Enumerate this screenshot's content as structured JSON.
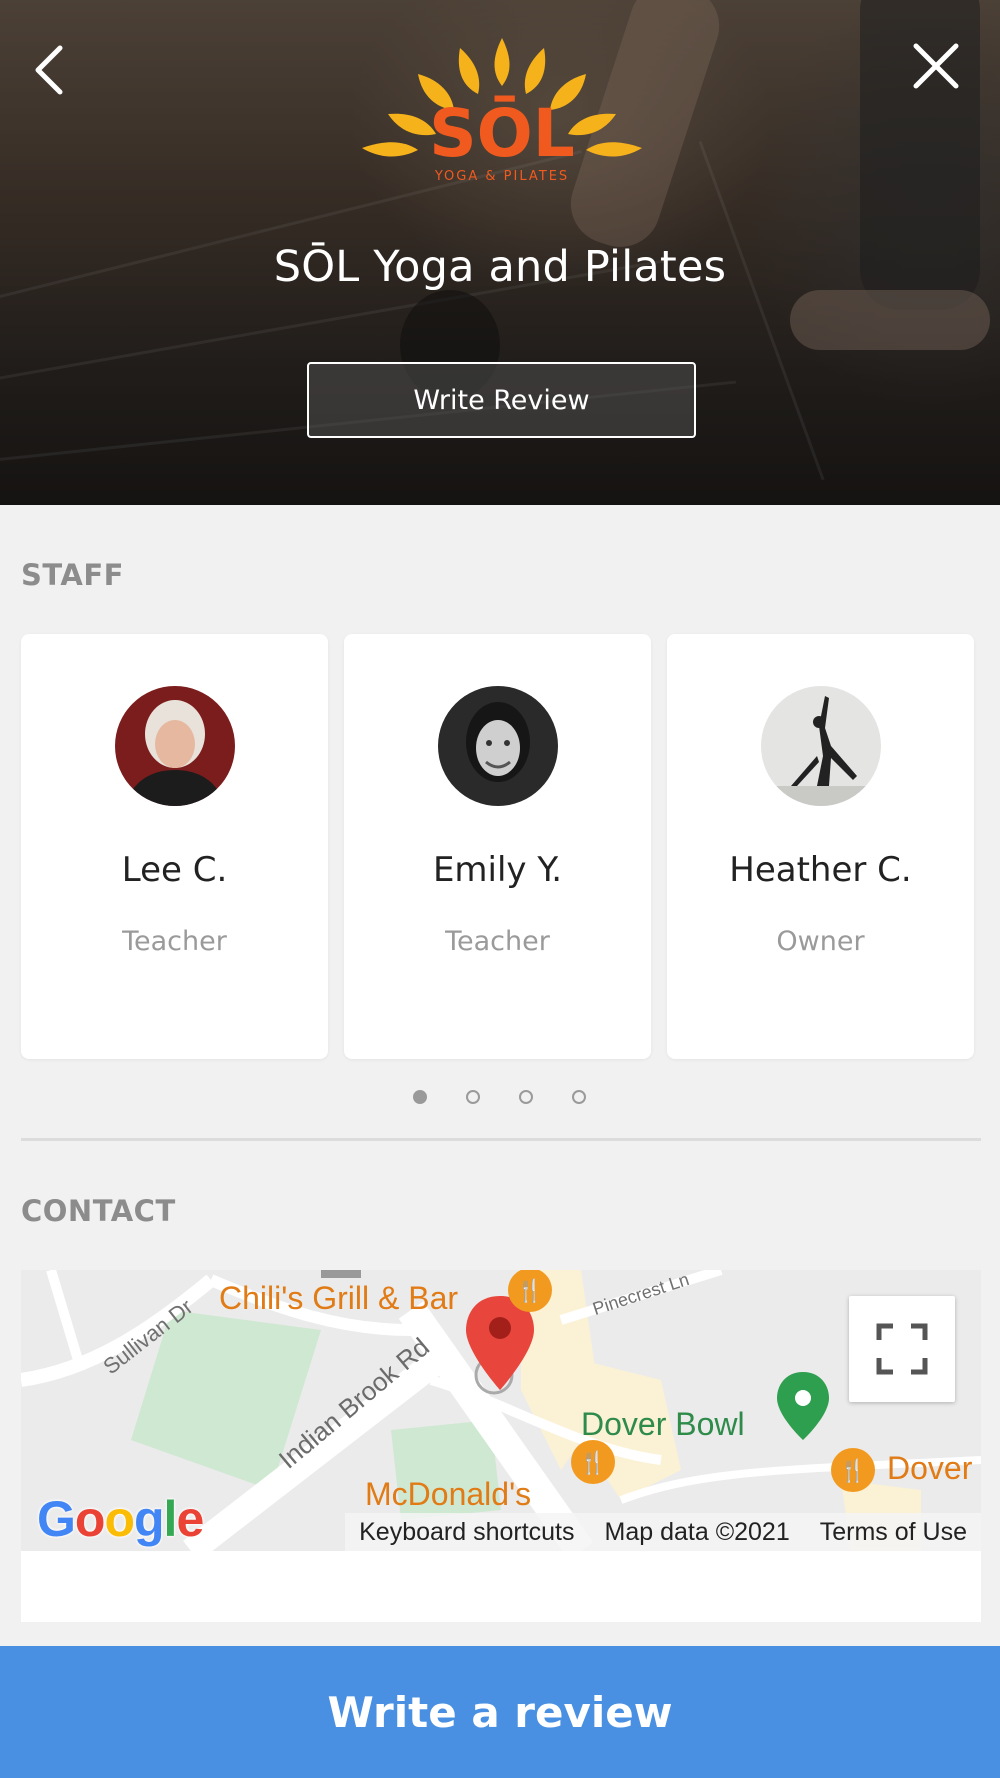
{
  "header": {
    "business_name": "SŌL Yoga and Pilates",
    "write_review_label": "Write Review",
    "logo_text": "SŌL",
    "logo_subtext": "YOGA & PILATES"
  },
  "staff": {
    "section_label": "STAFF",
    "members": [
      {
        "name": "Lee C.",
        "role": "Teacher"
      },
      {
        "name": "Emily Y.",
        "role": "Teacher"
      },
      {
        "name": "Heather C.",
        "role": "Owner"
      }
    ],
    "page_count": 4,
    "active_page": 1
  },
  "contact": {
    "section_label": "CONTACT",
    "map": {
      "poi": [
        "Chili's Grill & Bar",
        "Dover Bowl",
        "McDonald's",
        "Dover"
      ],
      "streets": [
        "Sullivan Dr",
        "Indian Brook Rd",
        "Pinecrest Ln"
      ],
      "provider": "Google",
      "footer": {
        "keyboard_shortcuts": "Keyboard shortcuts",
        "map_data": "Map data ©2021",
        "terms": "Terms of Use"
      }
    }
  },
  "footer_button": {
    "label": "Write a review"
  },
  "colors": {
    "accent_blue": "#4a90e2",
    "logo_orange": "#f05a1e",
    "logo_yellow": "#f6b21b",
    "map_pin_red": "#e8453c",
    "map_pin_green": "#2e9e4f"
  }
}
